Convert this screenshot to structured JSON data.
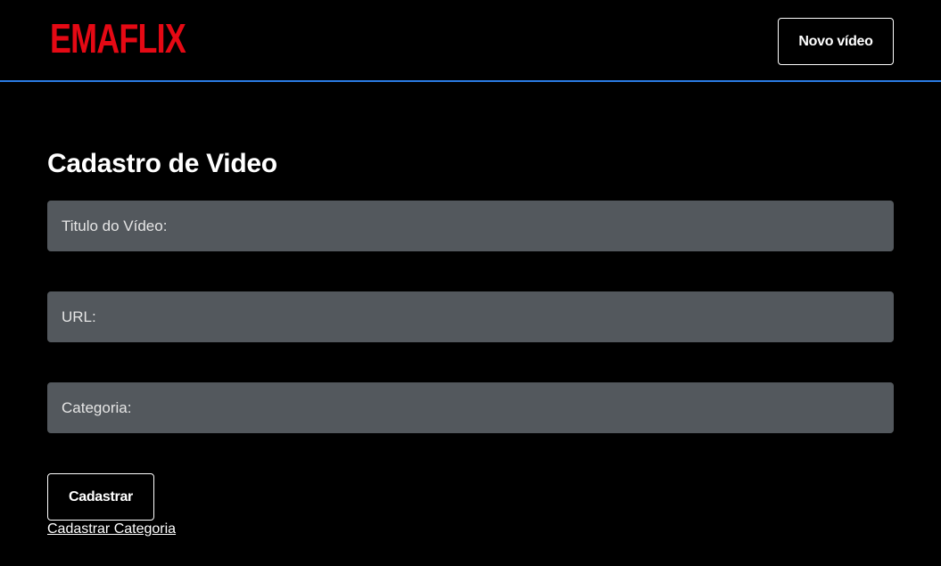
{
  "header": {
    "logo_text": "EMAFLIX",
    "new_video_label": "Novo vídeo"
  },
  "form": {
    "title": "Cadastro de Video",
    "fields": [
      {
        "label": "Titulo do Vídeo:",
        "value": ""
      },
      {
        "label": "URL:",
        "value": ""
      },
      {
        "label": "Categoria:",
        "value": ""
      }
    ],
    "submit_label": "Cadastrar",
    "category_link": "Cadastrar Categoria"
  },
  "colors": {
    "background": "#000000",
    "brand": "#e50914",
    "header_border": "#2a7ae2",
    "field_background": "#53585d",
    "text": "#ffffff"
  }
}
